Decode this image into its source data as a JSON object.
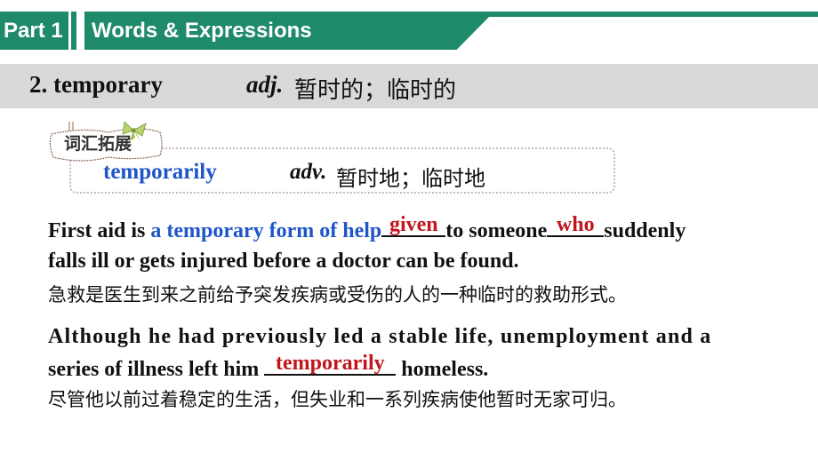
{
  "header": {
    "part_label": "Part 1",
    "section_title": "Words & Expressions",
    "accent_color": "#1e8a6a"
  },
  "entry": {
    "word": "2. temporary",
    "pos": "adj.",
    "definition": "暂时的；临时的"
  },
  "vocab_expansion": {
    "tag_label": "词汇拓展",
    "word": "temporarily",
    "pos": "adv.",
    "definition": "暂时地；临时地"
  },
  "examples": [
    {
      "line1": {
        "prefix": "First aid is ",
        "highlight": "a temporary form of help",
        "blank1_answer": "given",
        "middle": "to someone",
        "blank2_answer": "who",
        "suffix": "suddenly"
      },
      "line2": "falls ill or gets injured before a doctor can be found.",
      "translation": "急救是医生到来之前给予突发疾病或受伤的人的一种临时的救助形式。"
    },
    {
      "line1": "Although he had previously led a stable life, unemployment and a",
      "line2": {
        "prefix": "series of illness left him ",
        "blank_answer": "temporarily",
        "suffix": " homeless."
      },
      "translation": "尽管他以前过着稳定的生活，但失业和一系列疾病使他暂时无家可归。"
    }
  ],
  "colors": {
    "highlight_blue": "#1f55c8",
    "answer_red": "#c0161c",
    "band_gray": "#d9d9d9"
  }
}
